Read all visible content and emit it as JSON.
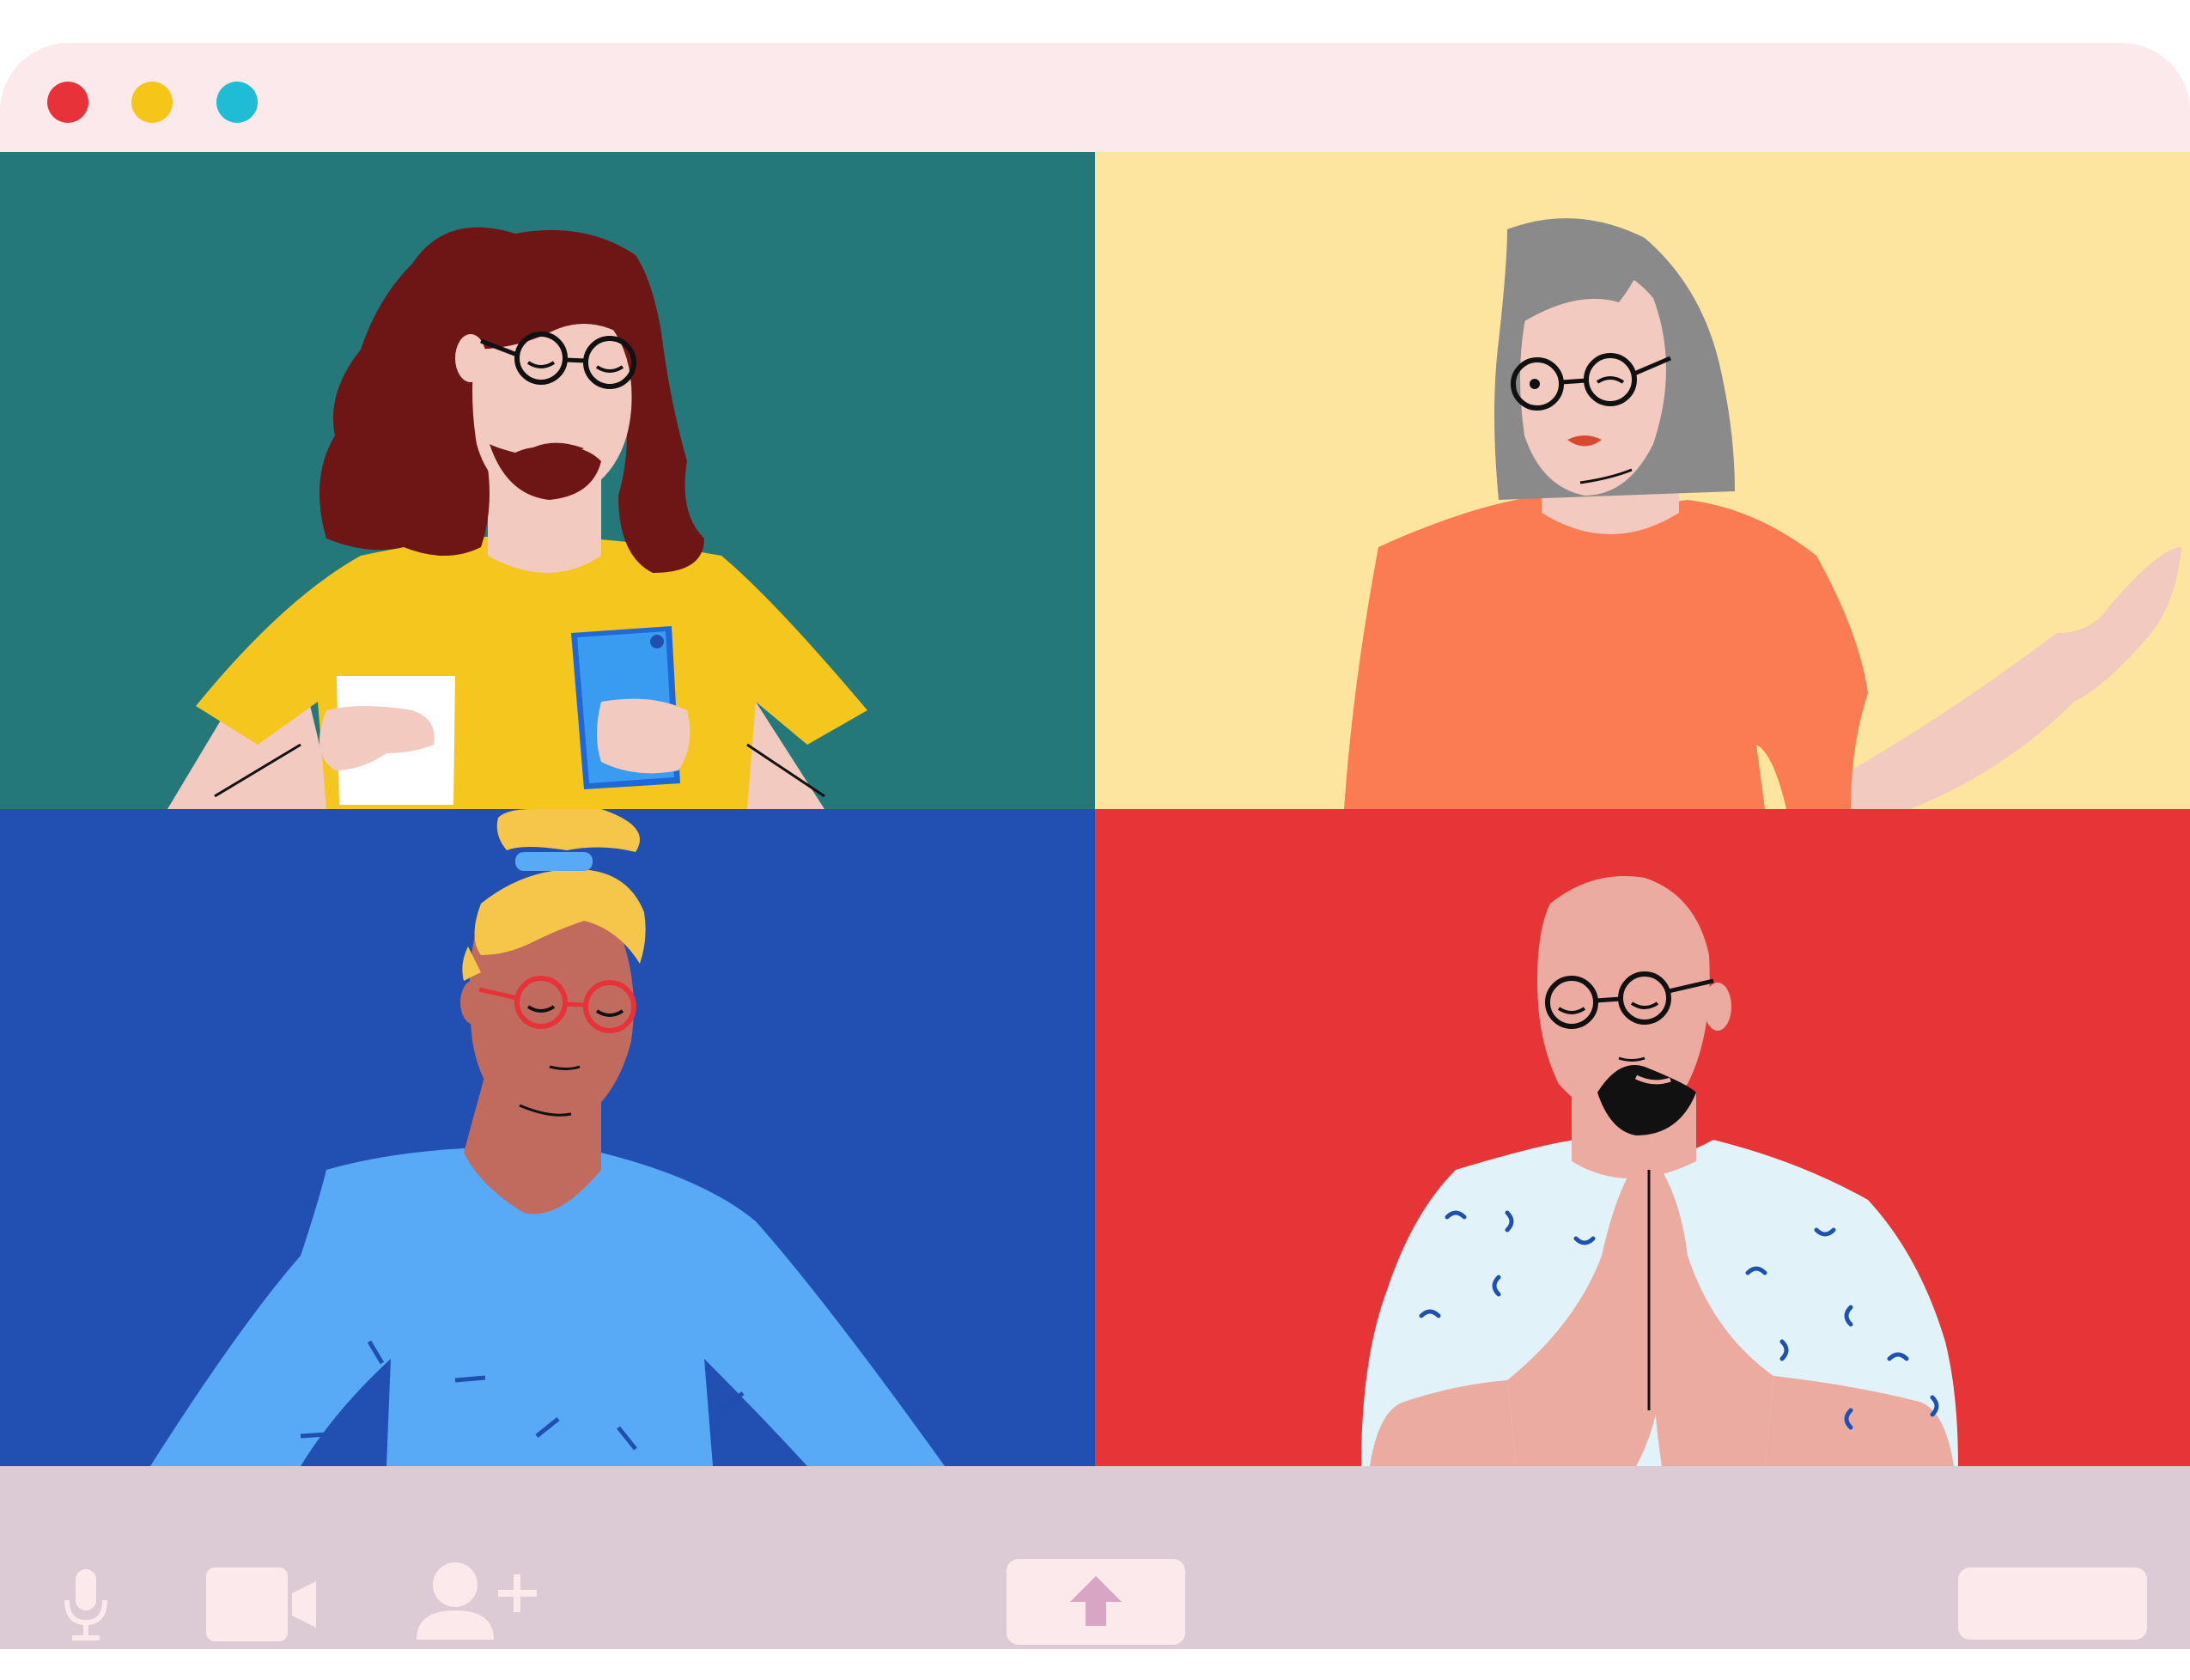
{
  "window": {
    "controls": [
      {
        "name": "close",
        "color": "#e8323a"
      },
      {
        "name": "minimize",
        "color": "#f5c518"
      },
      {
        "name": "maximize",
        "color": "#1fbcd6"
      }
    ],
    "background": "#fbe9ec"
  },
  "call": {
    "participants": [
      {
        "tile": "top-left",
        "background": "#24787a",
        "shirt": "#f5c61d",
        "hair": "#6e1616",
        "features": [
          "long-hair",
          "beard",
          "glasses",
          "phone",
          "cup"
        ]
      },
      {
        "tile": "top-right",
        "background": "#fde59f",
        "shirt": "#fb7b52",
        "hair": "#8a8a8a",
        "features": [
          "grey-bob-hair",
          "glasses",
          "waving-hand"
        ]
      },
      {
        "tile": "bottom-left",
        "background": "#214fb2",
        "shirt": "#58a9f6",
        "hair": "#f6c64a",
        "features": [
          "hair-bun",
          "red-glasses"
        ]
      },
      {
        "tile": "bottom-right",
        "background": "#e73537",
        "shirt": "#e1f3f9",
        "hair": "none",
        "features": [
          "bald",
          "goatee",
          "glasses",
          "praying-hands"
        ]
      }
    ]
  },
  "toolbar": {
    "background": "#dccbd5",
    "icons": {
      "microphone": "microphone-icon",
      "camera": "video-camera-icon",
      "add_person": "add-person-icon",
      "share": "share-screen-arrow-icon"
    }
  }
}
